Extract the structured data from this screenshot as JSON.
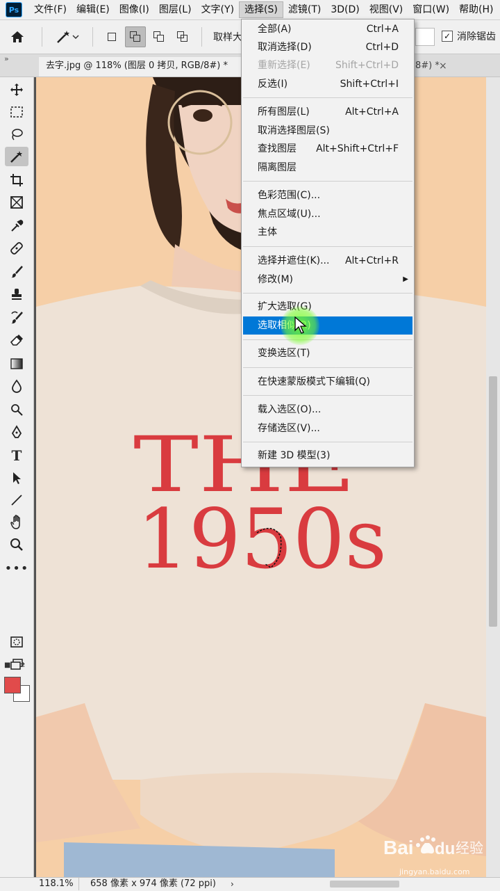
{
  "app": {
    "logo_text": "Ps"
  },
  "menubar": {
    "items": [
      "文件(F)",
      "编辑(E)",
      "图像(I)",
      "图层(L)",
      "文字(Y)",
      "选择(S)",
      "滤镜(T)",
      "3D(D)",
      "视图(V)",
      "窗口(W)",
      "帮助(H)"
    ],
    "active": "选择(S)"
  },
  "options": {
    "sample_label": "取样大",
    "anti_alias_label": "消除锯齿",
    "anti_alias_checked": true
  },
  "tabs": {
    "collapse_glyph": "»",
    "active_doc": "去字.jpg @ 118% (图层 0 拷贝, RGB/8#) *",
    "second_doc_suffix": "8#) *",
    "close_glyph": "×"
  },
  "select_menu": {
    "items": [
      {
        "label": "全部(A)",
        "shortcut": "Ctrl+A"
      },
      {
        "label": "取消选择(D)",
        "shortcut": "Ctrl+D"
      },
      {
        "label": "重新选择(E)",
        "shortcut": "Shift+Ctrl+D",
        "disabled": true
      },
      {
        "label": "反选(I)",
        "shortcut": "Shift+Ctrl+I"
      },
      {
        "label": "所有图层(L)",
        "shortcut": "Alt+Ctrl+A"
      },
      {
        "label": "取消选择图层(S)",
        "shortcut": ""
      },
      {
        "label": "查找图层",
        "shortcut": "Alt+Shift+Ctrl+F"
      },
      {
        "label": "隔离图层",
        "shortcut": ""
      },
      {
        "label": "色彩范围(C)...",
        "shortcut": ""
      },
      {
        "label": "焦点区域(U)...",
        "shortcut": ""
      },
      {
        "label": "主体",
        "shortcut": ""
      },
      {
        "label": "选择并遮住(K)...",
        "shortcut": "Alt+Ctrl+R"
      },
      {
        "label": "修改(M)",
        "shortcut": "",
        "submenu": true
      },
      {
        "label": "扩大选取(G)",
        "shortcut": ""
      },
      {
        "label": "选取相似(R)",
        "shortcut": "",
        "highlighted": true
      },
      {
        "label": "变换选区(T)",
        "shortcut": ""
      },
      {
        "label": "在快速蒙版模式下编辑(Q)",
        "shortcut": ""
      },
      {
        "label": "载入选区(O)...",
        "shortcut": ""
      },
      {
        "label": "存储选区(V)...",
        "shortcut": ""
      },
      {
        "label": "新建 3D 模型(3)",
        "shortcut": ""
      }
    ]
  },
  "canvas": {
    "shirt_line1": "THE",
    "shirt_line2": "1950s",
    "shirt_text_color": "#d93b3f"
  },
  "colors": {
    "foreground": "#e14b4b",
    "background": "#ffffff",
    "highlight": "#0078d7"
  },
  "status": {
    "zoom": "118.1%",
    "doc_size": "658 像素 x 974 像素 (72 ppi)",
    "arrow": "›"
  },
  "watermark": {
    "brand": "Bai",
    "brand2": "du",
    "brand_cn": "经验",
    "url": "jingyan.baidu.com"
  }
}
